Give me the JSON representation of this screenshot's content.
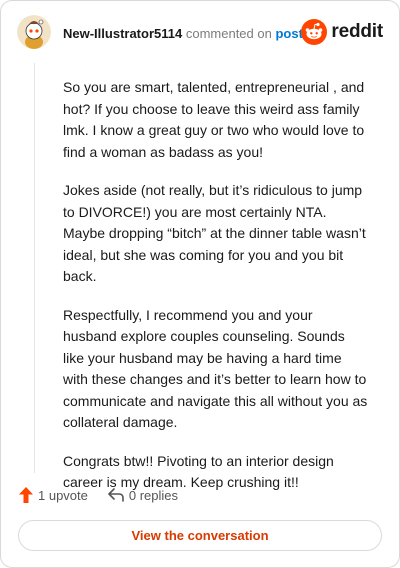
{
  "comment": {
    "username": "New-Illustrator5114",
    "action_text": "commented on",
    "post_link": "post",
    "paragraphs": [
      "So you are smart, talented, entrepreneurial , and hot? If you choose to leave this weird ass family lmk. I know a great guy or two who would love to find a woman as badass as you!",
      "Jokes aside (not really, but it’s ridiculous to jump to DIVORCE!) you are most certainly NTA. Maybe dropping “bitch” at the dinner table wasn’t ideal, but she was coming for you and you bit back.",
      "Respectfully, I recommend you and your husband explore couples counseling. Sounds like your husband may be having a hard time with these changes and it’s better to learn how to communicate and navigate this all without you as collateral damage.",
      "Congrats btw!! Pivoting to an interior design career is my dream. Keep crushing it!!"
    ],
    "upvotes": "1 upvote",
    "replies": "0 replies"
  },
  "brand": {
    "name": "reddit",
    "icon": "reddit-snoo-icon",
    "color": "#ff4500"
  },
  "avatar_icon": "snoo-avatar-icon",
  "upvote_icon": "upvote-arrow-icon",
  "reply_icon": "reply-arrow-icon",
  "cta": {
    "label": "View the conversation",
    "color": "#d93a00"
  }
}
